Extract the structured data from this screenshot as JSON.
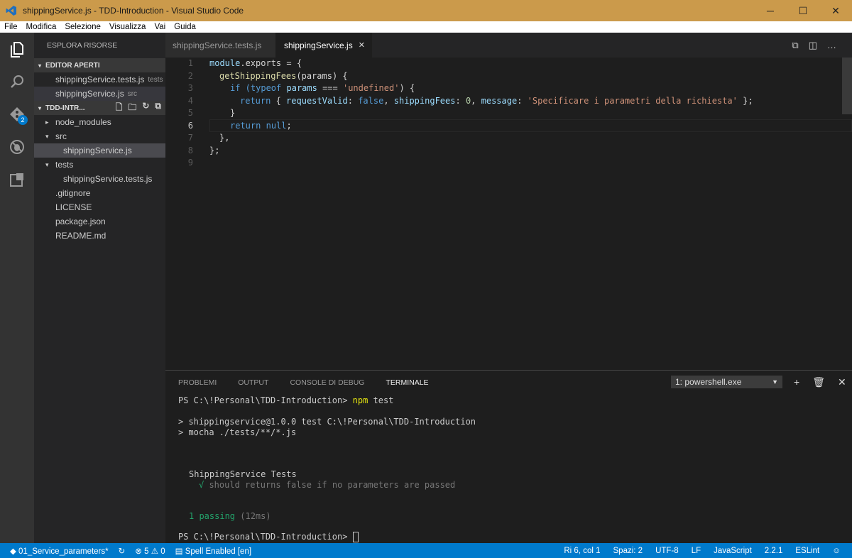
{
  "window": {
    "title": "shippingService.js - TDD-Introduction - Visual Studio Code"
  },
  "menu": [
    "File",
    "Modifica",
    "Selezione",
    "Visualizza",
    "Vai",
    "Guida"
  ],
  "activity": {
    "badge": "2"
  },
  "sidebar": {
    "title": "ESPLORA RISORSE",
    "open_editors_title": "EDITOR APERTI",
    "open_editors": [
      {
        "name": "shippingService.tests.js",
        "hint": "tests"
      },
      {
        "name": "shippingService.js",
        "hint": "src"
      }
    ],
    "project_title": "TDD-INTR...",
    "tree": [
      {
        "label": "node_modules",
        "arrow": "▸"
      },
      {
        "label": "src",
        "arrow": "▾"
      },
      {
        "label": "shippingService.js",
        "arrow": ""
      },
      {
        "label": "tests",
        "arrow": "▾"
      },
      {
        "label": "shippingService.tests.js",
        "arrow": ""
      },
      {
        "label": ".gitignore",
        "arrow": ""
      },
      {
        "label": "LICENSE",
        "arrow": ""
      },
      {
        "label": "package.json",
        "arrow": ""
      },
      {
        "label": "README.md",
        "arrow": ""
      }
    ]
  },
  "tabs": [
    {
      "label": "shippingService.tests.js"
    },
    {
      "label": "shippingService.js",
      "close": "✕"
    }
  ],
  "editor": {
    "line_numbers": [
      "1",
      "2",
      "3",
      "4",
      "5",
      "6",
      "7",
      "8",
      "9"
    ],
    "code": {
      "l1a": "module",
      "l1b": ".exports = {",
      "l2a": "getShippingFees",
      "l2b": "(params) {",
      "l3a": "if (",
      "l3b": "typeof",
      "l3c": "params",
      "l3d": " === ",
      "l3e": "'undefined'",
      "l3f": ") {",
      "l4a": "return",
      "l4b": " { ",
      "l4c": "requestValid",
      "l4d": ": ",
      "l4e": "false",
      "l4f": ", ",
      "l4g": "shippingFees",
      "l4h": ": ",
      "l4i": "0",
      "l4j": ", ",
      "l4k": "message",
      "l4l": ": ",
      "l4m": "'Specificare i parametri della richiesta'",
      "l4n": " };",
      "l5": "}",
      "l6a": "return",
      "l6b": " ",
      "l6c": "null",
      "l6d": ";",
      "l7": "},",
      "l8": "};"
    }
  },
  "panel": {
    "tabs": [
      "PROBLEMI",
      "OUTPUT",
      "CONSOLE DI DEBUG",
      "TERMINALE"
    ],
    "terminal_select": "1: powershell.exe",
    "lines": {
      "p1a": "PS C:\\!Personal\\TDD-Introduction> ",
      "p1b": "npm",
      "p1c": " test",
      "p2": "> shippingservice@1.0.0 test C:\\!Personal\\TDD-Introduction",
      "p3": "> mocha ./tests/**/*.js",
      "p4": "ShippingService Tests",
      "p5a": "√",
      "p5b": " should returns false if no parameters are passed",
      "p6a": "1 passing",
      "p6b": " (12ms)",
      "p7": "PS C:\\!Personal\\TDD-Introduction> "
    }
  },
  "status": {
    "branch": "01_Service_parameters*",
    "errors": "5",
    "warnings": "0",
    "spell": "Spell Enabled [en]",
    "position": "Ri 6, col 1",
    "indent": "Spazi: 2",
    "encoding": "UTF-8",
    "eol": "LF",
    "language": "JavaScript",
    "version": "2.2.1",
    "linter": "ESLint"
  }
}
